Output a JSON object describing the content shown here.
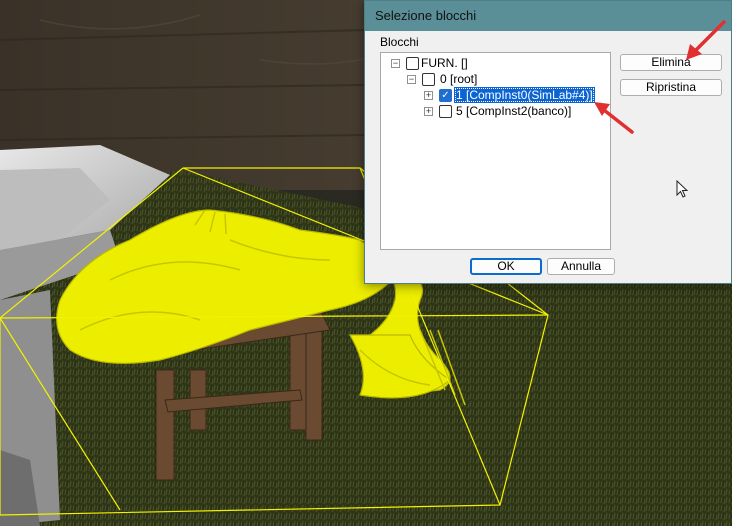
{
  "dialog": {
    "title": "Selezione blocchi",
    "group_label": "Blocchi",
    "tree": [
      {
        "label": "FURN. []",
        "expander": "−",
        "checked": false,
        "selected": false
      },
      {
        "label": "0 [root]",
        "expander": "−",
        "checked": false,
        "selected": false
      },
      {
        "label": "1 [CompInst0(SimLab#4)]",
        "expander": "+",
        "checked": true,
        "selected": true
      },
      {
        "label": "5 [CompInst2(banco)]",
        "expander": "+",
        "checked": false,
        "selected": false
      }
    ],
    "buttons": {
      "delete": "Elimina",
      "restore": "Ripristina",
      "ok": "OK",
      "cancel": "Annulla"
    }
  },
  "colors": {
    "titlebar": "#5b8f98",
    "selection": "#0a64d4",
    "annotation_arrow": "#e03030",
    "bounding_box": "#f2f200",
    "cloth": "#f0f000"
  },
  "icons": {
    "expand_collapse": "tree-toggle-icon",
    "checkbox": "checkbox-icon",
    "cursor": "mouse-pointer-icon",
    "annotation": "red-arrow-icon"
  }
}
